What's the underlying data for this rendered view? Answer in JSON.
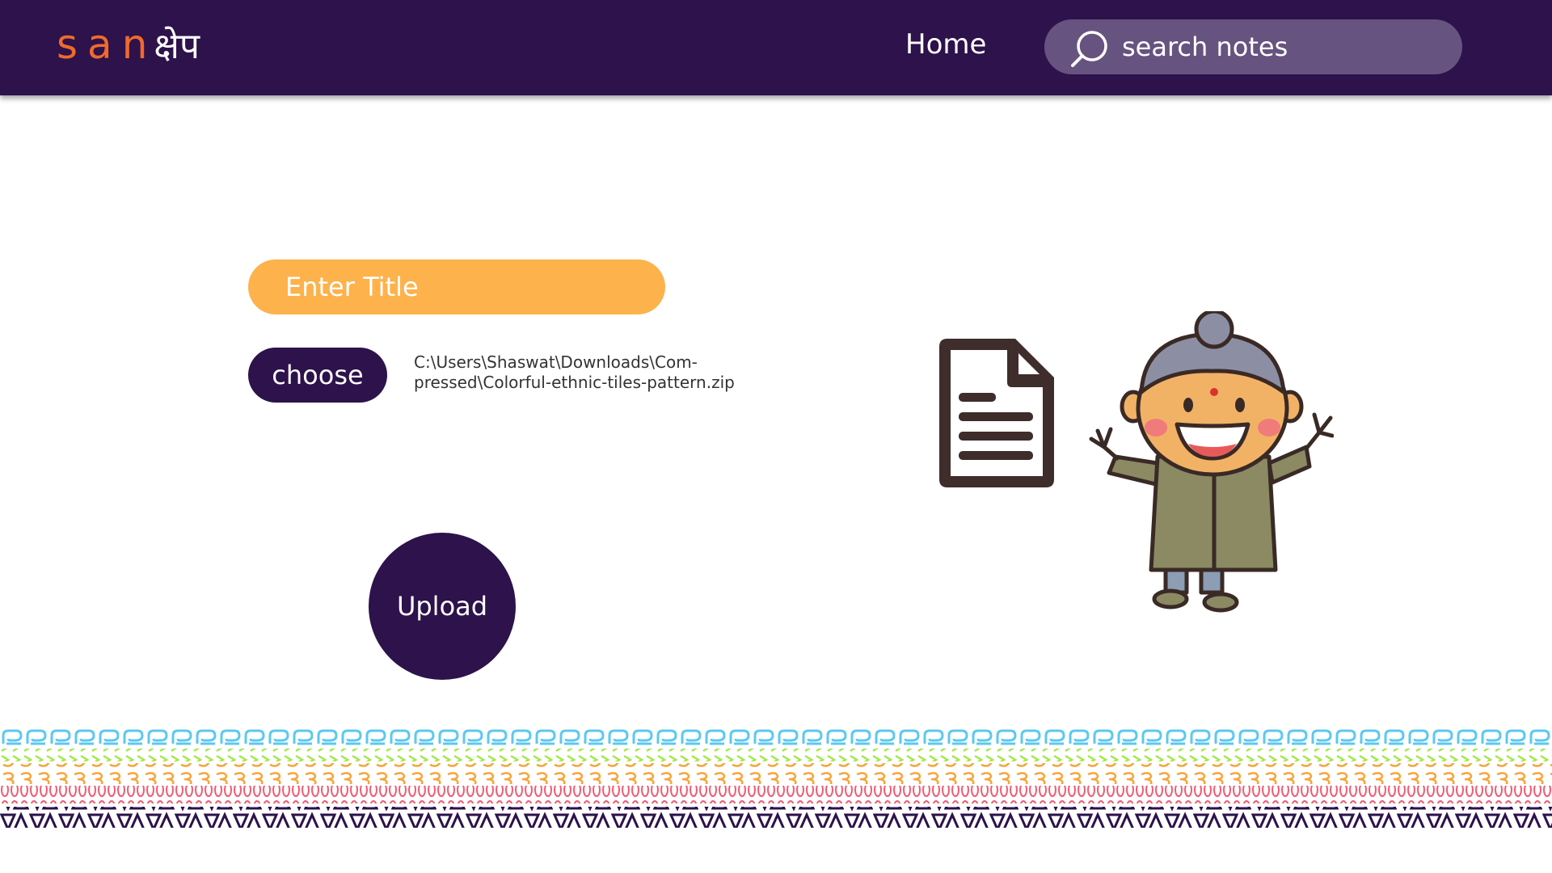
{
  "navbar": {
    "logo": {
      "latin": "san",
      "devanagari": "क्षेप"
    },
    "home_label": "Home",
    "search": {
      "placeholder": "search notes",
      "icon": "search-icon"
    }
  },
  "form": {
    "title_placeholder": "Enter Title",
    "choose_label": "choose",
    "file_path_line1": "C:\\Users\\Shaswat\\Downloads\\Com-",
    "file_path_line2": "pressed\\Colorful-ethnic-tiles-pattern.zip",
    "upload_label": "Upload"
  },
  "illustrations": {
    "document": "document-icon",
    "character": "grandmother-cartoon",
    "footer": "ethnic-tiles-pattern-border"
  },
  "colors": {
    "navbar": "#2d124b",
    "logo_accent": "#ef6a2c",
    "search_bg": "#67537f",
    "title_input": "#fdb24b",
    "button": "#2d124b",
    "pattern": [
      "#5bc9f0",
      "#a3e84a",
      "#f7a53a",
      "#f25a72",
      "#2d124b"
    ]
  }
}
